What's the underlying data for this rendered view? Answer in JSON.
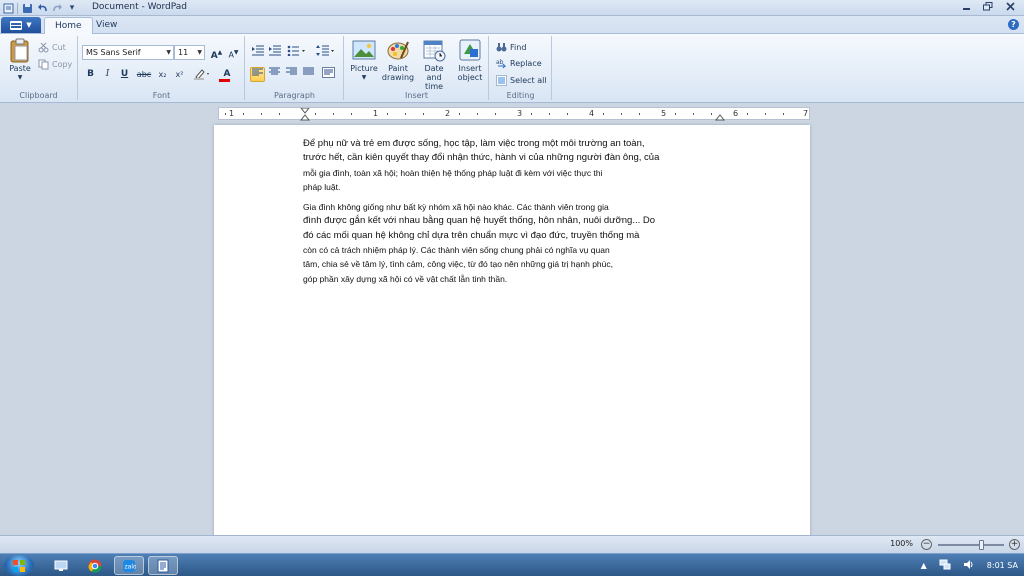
{
  "window": {
    "title": "Document - WordPad",
    "controls": [
      "minimize",
      "restore",
      "close"
    ]
  },
  "quick_access": [
    "save-icon",
    "undo-icon",
    "redo-icon",
    "customize-icon"
  ],
  "tabs": [
    {
      "label": "Home",
      "active": true
    },
    {
      "label": "View",
      "active": false
    }
  ],
  "ribbon": {
    "clipboard": {
      "group_label": "Clipboard",
      "paste_label": "Paste",
      "cut_label": "Cut",
      "copy_label": "Copy"
    },
    "font": {
      "group_label": "Font",
      "font_family": "MS Sans Serif",
      "font_size": "11",
      "grow_label": "A",
      "shrink_label": "A",
      "bold": "B",
      "italic": "I",
      "underline": "U",
      "strike": "abc",
      "subscript": "x₂",
      "superscript": "x²",
      "color_label": "A"
    },
    "paragraph": {
      "group_label": "Paragraph"
    },
    "insert": {
      "group_label": "Insert",
      "picture_label": "Picture",
      "paint_label_1": "Paint",
      "paint_label_2": "drawing",
      "datetime_label_1": "Date and",
      "datetime_label_2": "time",
      "object_label_1": "Insert",
      "object_label_2": "object"
    },
    "editing": {
      "group_label": "Editing",
      "find_label": "Find",
      "replace_label": "Replace",
      "selectall_label": "Select all"
    }
  },
  "ruler": {
    "marks": [
      "1",
      "1",
      "2",
      "3",
      "4",
      "5",
      "6",
      "7"
    ]
  },
  "document": {
    "paragraphs": [
      {
        "lines": [
          "Để phụ nữ và trẻ em được sống, học tập, làm việc trong một môi trường an toàn,",
          "trước hết, cần kiên quyết thay đổi nhận thức, hành vi của những người đàn ông, của",
          "mỗi gia đình, toàn xã hội; hoàn thiện hệ thống pháp luật đi kèm với việc thực thi",
          "pháp luật."
        ]
      },
      {
        "lines": [
          "Gia đình không giống như bất kỳ nhóm xã hội nào khác. Các thành viên trong gia",
          "đình được gắn kết với nhau bằng quan hệ huyết thống, hôn nhân, nuôi dưỡng... Do",
          "đó các mối quan hệ không chỉ dựa trên chuẩn mực vì đạo đức, truyền thống mà",
          "còn có cả trách nhiệm pháp lý. Các thành viên sống chung phải có nghĩa vụ quan",
          "tâm, chia sẻ về tâm lý, tình cảm, công việc, từ đó tạo nên những giá trị hạnh phúc,",
          "góp phần xây dựng xã hội có về vật chất lẫn tinh thần."
        ]
      }
    ]
  },
  "status": {
    "zoom_label": "100%",
    "zoom_fraction": 0.66
  },
  "taskbar": {
    "clock": "8:01 SA",
    "buttons": [
      "desktop-icon",
      "chrome-icon",
      "zalo-icon",
      "wordpad-icon"
    ]
  }
}
